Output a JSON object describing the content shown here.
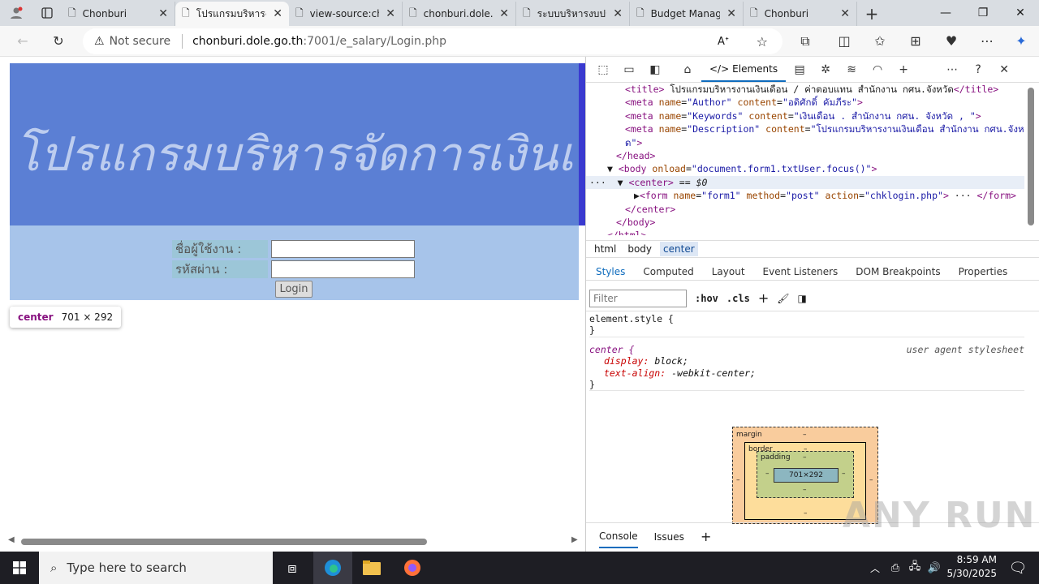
{
  "tabs": [
    {
      "title": "Chonburi",
      "active": false
    },
    {
      "title": "โปรแกรมบริหารงาน",
      "active": true
    },
    {
      "title": "view-source:ch",
      "active": false
    },
    {
      "title": "chonburi.dole.g",
      "active": false
    },
    {
      "title": "ระบบบริหารงบประ",
      "active": false
    },
    {
      "title": "Budget Manag",
      "active": false
    },
    {
      "title": "Chonburi",
      "active": false
    }
  ],
  "address": {
    "security": "Not secure",
    "host": "chonburi.dole.go.th",
    "path": ":7001/e_salary/Login.php"
  },
  "banner": {
    "text": "โปรแกรมบริหารจัดการเงินเดือน E-Salary สำนัก"
  },
  "login": {
    "user_label": "ชื่อผู้ใช้งาน :",
    "pass_label": "รหัสผ่าน :",
    "button": "Login"
  },
  "highlight": {
    "tag": "center",
    "size": "701 × 292"
  },
  "devtools": {
    "elements_tab": "Elements",
    "dom_lines": [
      {
        "indent": 4,
        "html": "<span class='tg'>&lt;title&gt;</span> โปรแกรมบริหารงานเงินเดือน / ค่าตอบแทน สำนักงาน กศน.จังหวัด<span class='tg'>&lt;/title&gt;</span>"
      },
      {
        "indent": 4,
        "html": "<span class='tg'>&lt;meta</span> <span class='at'>name</span>=<span class='av'>\"Author\"</span> <span class='at'>content</span>=<span class='av'>\"อดิศักดิ์  คัมภีระ\"</span><span class='tg'>&gt;</span>"
      },
      {
        "indent": 4,
        "html": "<span class='tg'>&lt;meta</span> <span class='at'>name</span>=<span class='av'>\"Keywords\"</span> <span class='at'>content</span>=<span class='av'>\"เงินเดือน . สำนักงาน กศน. จังหวัด , \"</span><span class='tg'>&gt;</span>"
      },
      {
        "indent": 4,
        "html": "<span class='tg'>&lt;meta</span> <span class='at'>name</span>=<span class='av'>\"Description\"</span> <span class='at'>content</span>=<span class='av'>\"โปรแกรมบริหารงานเงินเดือน สำนักงาน กศน.จังหวั</span>"
      },
      {
        "indent": 4,
        "html": "<span class='av'>ด\"</span><span class='tg'>&gt;</span>"
      },
      {
        "indent": 3,
        "html": "<span class='tg'>&lt;/head&gt;</span>"
      },
      {
        "indent": 2,
        "html": "▼ <span class='tg'>&lt;body</span> <span class='at'>onload</span>=<span class='av'>\"document.form1.txtUser.focus()\"</span><span class='tg'>&gt;</span>"
      },
      {
        "indent": 0,
        "sel": true,
        "html": "··· &nbsp;▼ <span class='tg'>&lt;center&gt;</span> == <i>$0</i>"
      },
      {
        "indent": 5,
        "html": "▶<span class='tg'>&lt;form</span> <span class='at'>name</span>=<span class='av'>\"form1\"</span> <span class='at'>method</span>=<span class='av'>\"post\"</span> <span class='at'>action</span>=<span class='av'>\"chklogin.php\"</span><span class='tg'>&gt;</span> ··· <span class='tg'>&lt;/form&gt;</span>"
      },
      {
        "indent": 4,
        "html": "<span class='tg'>&lt;/center&gt;</span>"
      },
      {
        "indent": 3,
        "html": "<span class='tg'>&lt;/body&gt;</span>"
      },
      {
        "indent": 2,
        "html": "<span class='tg'>&lt;/html&gt;</span>"
      }
    ],
    "crumbs": [
      "html",
      "body",
      "center"
    ],
    "subtabs": [
      "Styles",
      "Computed",
      "Layout",
      "Event Listeners",
      "DOM Breakpoints",
      "Properties"
    ],
    "filter_placeholder": "Filter",
    "hov": ":hov",
    "cls": ".cls",
    "rule1": {
      "selector": "element.style {",
      "close": "}"
    },
    "rule2": {
      "selector": "center {",
      "source": "user agent stylesheet",
      "p1": "display",
      "v1": "block;",
      "p2": "text-align",
      "v2": "-webkit-center;",
      "close": "}"
    },
    "boxmodel": {
      "margin": "margin",
      "border": "border",
      "padding": "padding",
      "content": "701×292",
      "dash": "–"
    },
    "bottom_tabs": [
      "Console",
      "Issues"
    ]
  },
  "watermark": "ANY  RUN",
  "taskbar": {
    "search": "Type here to search",
    "time": "8:59 AM",
    "date": "5/30/2025"
  }
}
